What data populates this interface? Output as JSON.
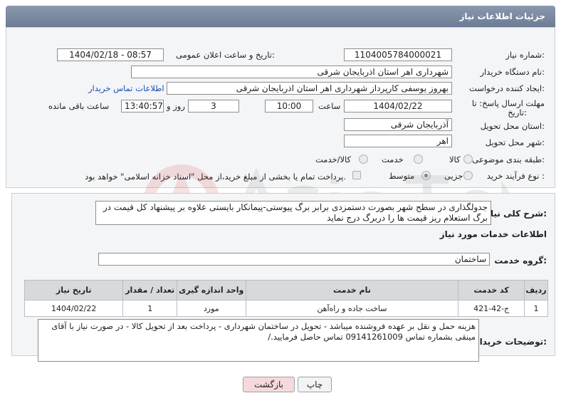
{
  "header": {
    "title": "جزئیات اطلاعات نیاز"
  },
  "form": {
    "need_number_label": "شماره نیاز:",
    "need_number": "1104005784000021",
    "announce_label": "تاریخ و ساعت اعلان عمومی:",
    "announce_value": "1404/02/18 - 08:57",
    "buyer_org_label": "نام دستگاه خریدار:",
    "buyer_org": "شهرداری اهر استان اذربایجان شرقی",
    "requester_label": "ایجاد کننده درخواست:",
    "requester": "بهروز یوسفی کارپرداز شهرداری اهر استان اذربایجان شرقی",
    "contact_link": "اطلاعات تماس خریدار",
    "deadline_label_1": "مهلت ارسال پاسخ: تا",
    "deadline_label_2": "تاریخ:",
    "deadline_date": "1404/02/22",
    "time_label": "ساعت",
    "deadline_time": "10:00",
    "days_value": "3",
    "days_label": "روز و",
    "remaining_time": "13:40:57",
    "remaining_label": "ساعت باقی مانده",
    "province_label": "استان محل تحویل:",
    "province": "آذربایجان شرقی",
    "city_label": "شهر محل تحویل:",
    "city": "اهر",
    "category_label": "طبقه بندی موضوعی:",
    "category_options": [
      "کالا",
      "خدمت",
      "کالا/خدمت"
    ],
    "category_selected": "خدمت",
    "process_label": "نوع فرآیند خرید :",
    "process_options": [
      "جزیی",
      "متوسط"
    ],
    "process_selected": "متوسط",
    "payment_text": "پرداخت تمام یا بخشی از مبلغ خرید،از محل \"اسناد خزانه اسلامی\" خواهد بود."
  },
  "details": {
    "summary_label": "شرح کلی نیاز:",
    "summary_text": "جدولگذاری در سطح شهر بصورت دستمزدی برابر برگ پیوستی-پیمانکار بایستی علاوه بر پیشنهاد کل قیمت در برگ استعلام ریز قیمت ها را دربرگ درج نماید",
    "services_title": "اطلاعات خدمات مورد نیاز",
    "service_group_label": "گروه خدمت:",
    "service_group": "ساختمان",
    "table": {
      "headers": [
        "ردیف",
        "کد خدمت",
        "نام خدمت",
        "واحد اندازه گیری",
        "تعداد / مقدار",
        "تاریخ نیاز"
      ],
      "rows": [
        [
          "1",
          "ج-42-421",
          "ساخت جاده و راه‌آهن",
          "مورد",
          "1",
          "1404/02/22"
        ]
      ]
    },
    "buyer_notes_label": "توضیحات خریدار:",
    "buyer_notes": "هزینه حمل و نقل بر عهده فروشنده میباشد - تحویل در ساختمان شهرداری - پرداخت بعد از تحویل کالا - در صورت نیاز با آقای مینقی بشماره تماس 09141261009 تماس حاصل فرمایید./"
  },
  "buttons": {
    "print": "چاپ",
    "back": "بازگشت"
  },
  "colors": {
    "header": "#7a889f",
    "back_button": "#f6d9dc",
    "link": "#1a4fb3"
  }
}
